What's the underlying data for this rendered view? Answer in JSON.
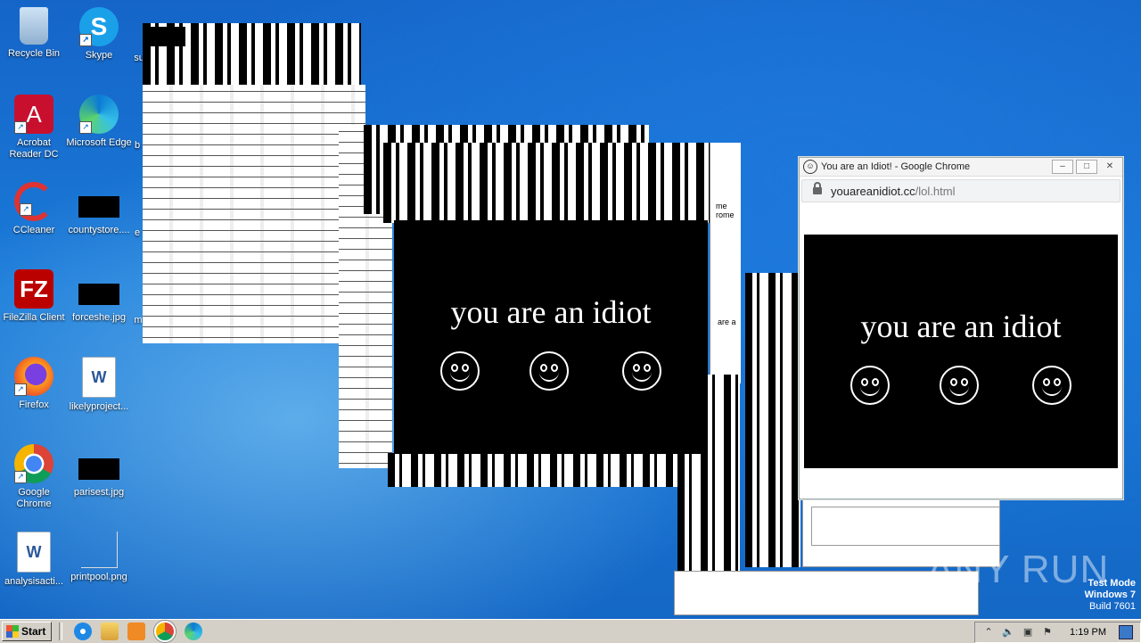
{
  "desktop": {
    "icons": [
      {
        "label": "Recycle Bin",
        "icon": "recycle-bin-icon"
      },
      {
        "label": "Skype",
        "icon": "skype-icon"
      },
      {
        "label": "Acrobat Reader DC",
        "icon": "acrobat-icon"
      },
      {
        "label": "Microsoft Edge",
        "icon": "edge-icon"
      },
      {
        "label": "CCleaner",
        "icon": "ccleaner-icon"
      },
      {
        "label": "countystore....",
        "icon": "image-file-icon"
      },
      {
        "label": "FileZilla Client",
        "icon": "filezilla-icon"
      },
      {
        "label": "forceshe.jpg",
        "icon": "image-file-icon"
      },
      {
        "label": "Firefox",
        "icon": "firefox-icon"
      },
      {
        "label": "likelyproject...",
        "icon": "word-doc-icon"
      },
      {
        "label": "Google Chrome",
        "icon": "chrome-icon"
      },
      {
        "label": "parisest.jpg",
        "icon": "image-file-icon"
      },
      {
        "label": "analysisacti...",
        "icon": "word-doc-icon"
      },
      {
        "label": "printpool.png",
        "icon": "image-file-icon"
      }
    ],
    "partial_labels": [
      "su",
      "b",
      "e",
      "m"
    ]
  },
  "popups": {
    "message": "you are an idiot"
  },
  "chrome_window": {
    "title": "You are an Idiot! - Google Chrome",
    "url_host": "youareanidiot.cc",
    "url_path": "/lol.html",
    "message": "you are an idiot"
  },
  "glitch_text": {
    "me": "me",
    "home": "rome",
    "are": "are a"
  },
  "taskbar": {
    "start_label": "Start",
    "clock": "1:19 PM"
  },
  "watermark": {
    "line1": "Test Mode",
    "line2": "Windows 7",
    "line3": "Build 7601",
    "brand": "ANY RUN"
  }
}
